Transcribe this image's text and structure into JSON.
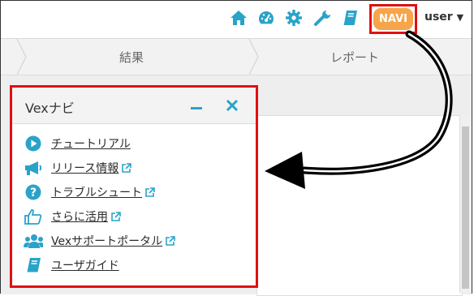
{
  "header": {
    "navi_label": "NAVI",
    "user_label": "user",
    "icons": [
      "home-icon",
      "dashboard-icon",
      "gear-icon",
      "wrench-icon",
      "manual-icon"
    ],
    "accent": "#2aa3c9",
    "navi_color": "#f5a54a",
    "highlight_color": "#e01010"
  },
  "breadcrumb": {
    "items": [
      "結果",
      "レポート"
    ]
  },
  "panel": {
    "title": "Vexナビ",
    "items": [
      {
        "label": "チュートリアル",
        "icon": "play-icon",
        "external": false
      },
      {
        "label": "リリース情報",
        "icon": "megaphone-icon",
        "external": true
      },
      {
        "label": "トラブルシュート",
        "icon": "help-icon",
        "external": true
      },
      {
        "label": "さらに活用",
        "icon": "thumbs-up-icon",
        "external": true
      },
      {
        "label": "Vexサポートポータル",
        "icon": "users-icon",
        "external": true
      },
      {
        "label": "ユーザガイド",
        "icon": "book-icon",
        "external": false
      }
    ]
  }
}
